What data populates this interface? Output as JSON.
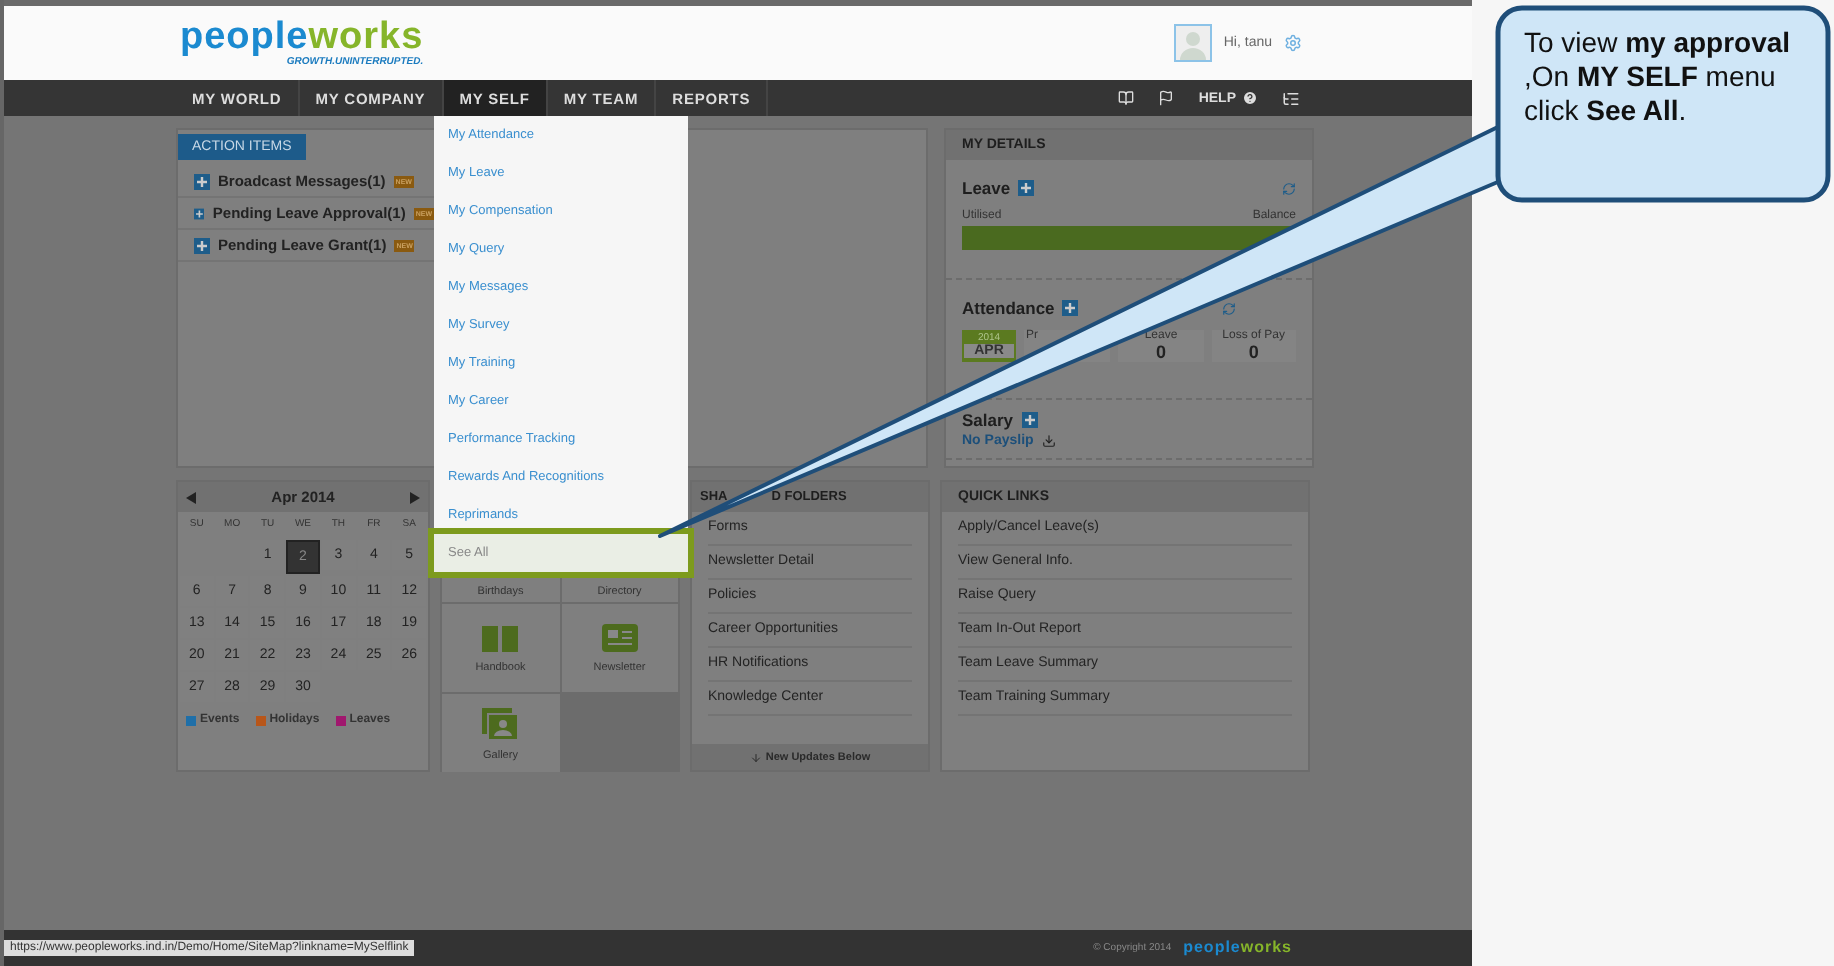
{
  "header": {
    "logo_text": "peopleworks",
    "tagline": "GROWTH.UNINTERRUPTED.",
    "greeting": "Hi, tanu"
  },
  "nav": {
    "items": [
      {
        "label": "MY WORLD",
        "selected": false
      },
      {
        "label": "MY COMPANY",
        "selected": false
      },
      {
        "label": "MY SELF",
        "selected": true
      },
      {
        "label": "MY TEAM",
        "selected": false
      },
      {
        "label": "REPORTS",
        "selected": false
      }
    ],
    "help": "HELP"
  },
  "menu": {
    "items": [
      {
        "label": "My Attendance",
        "selected": false
      },
      {
        "label": "My Leave",
        "selected": false
      },
      {
        "label": "My Compensation",
        "selected": false
      },
      {
        "label": "My Query",
        "selected": false
      },
      {
        "label": "My Messages",
        "selected": false
      },
      {
        "label": "My Survey",
        "selected": false
      },
      {
        "label": "My Training",
        "selected": false
      },
      {
        "label": "My Career",
        "selected": false
      },
      {
        "label": "Performance Tracking",
        "selected": false
      },
      {
        "label": "Rewards And Recognitions",
        "selected": false
      },
      {
        "label": "Reprimands",
        "selected": false
      },
      {
        "label": "See All",
        "selected": true
      }
    ]
  },
  "action_items": {
    "tab": "ACTION ITEMS",
    "items": [
      {
        "label": "Broadcast Messages",
        "count": "(1)",
        "badge": "NEW"
      },
      {
        "label": "Pending Leave Approval",
        "count": "(1)",
        "badge": "NEW"
      },
      {
        "label": "Pending Leave Grant",
        "count": "(1)",
        "badge": "NEW"
      }
    ]
  },
  "my_details": {
    "title": "MY DETAILS",
    "leave": {
      "title": "Leave",
      "utilised": "Utilised",
      "balance": "Balance",
      "level": 1
    },
    "attendance": {
      "title": "Attendance",
      "year": "2014",
      "month": "APR",
      "columns": [
        {
          "label": "Pr"
        },
        {
          "label": "Leave",
          "value": "0"
        },
        {
          "label": "Loss of Pay",
          "value": "0"
        }
      ]
    },
    "salary": {
      "title": "Salary",
      "link": "No Payslip"
    }
  },
  "calendar": {
    "month": "Apr 2014",
    "weekdays": [
      "SU",
      "MO",
      "TU",
      "WE",
      "TH",
      "FR",
      "SA"
    ],
    "weeks": [
      {
        "days": [
          {
            "label": "1",
            "selected": false
          },
          {
            "label": "2",
            "selected": true
          },
          {
            "label": "3",
            "selected": false
          },
          {
            "label": "4",
            "selected": false
          },
          {
            "label": "5",
            "selected": false
          }
        ]
      },
      {
        "days": [
          {
            "label": "6",
            "selected": false
          },
          {
            "label": "7",
            "selected": false
          },
          {
            "label": "8",
            "selected": false
          },
          {
            "label": "9",
            "selected": false
          },
          {
            "label": "10",
            "selected": false
          },
          {
            "label": "11",
            "selected": false
          },
          {
            "label": "12",
            "selected": false
          }
        ]
      },
      {
        "days": [
          {
            "label": "13",
            "selected": false
          },
          {
            "label": "14",
            "selected": false
          },
          {
            "label": "15",
            "selected": false
          },
          {
            "label": "16",
            "selected": false
          },
          {
            "label": "17",
            "selected": false
          },
          {
            "label": "18",
            "selected": false
          },
          {
            "label": "19",
            "selected": false
          }
        ]
      },
      {
        "days": [
          {
            "label": "20",
            "selected": false
          },
          {
            "label": "21",
            "selected": false
          },
          {
            "label": "22",
            "selected": false
          },
          {
            "label": "23",
            "selected": false
          },
          {
            "label": "24",
            "selected": false
          },
          {
            "label": "25",
            "selected": false
          },
          {
            "label": "26",
            "selected": false
          }
        ]
      },
      {
        "days": [
          {
            "label": "27",
            "selected": false
          },
          {
            "label": "28",
            "selected": false
          },
          {
            "label": "29",
            "selected": false
          },
          {
            "label": "30",
            "selected": false
          }
        ]
      }
    ],
    "legend": [
      {
        "label": "Events",
        "color": "#1f6fa8"
      },
      {
        "label": "Holidays",
        "color": "#b8561a"
      },
      {
        "label": "Leaves",
        "color": "#a0186e"
      }
    ]
  },
  "tiles": [
    {
      "label": "Birthdays",
      "kind": "text"
    },
    {
      "label": "Directory",
      "kind": "text"
    },
    {
      "label": "Handbook",
      "kind": "book"
    },
    {
      "label": "Newsletter",
      "kind": "news"
    },
    {
      "label": "Gallery",
      "kind": "gallery"
    }
  ],
  "shared_folders": {
    "title_parts": [
      "SHA",
      "D FOLDERS"
    ],
    "items": [
      "Forms",
      "Newsletter Detail",
      "Policies",
      "Career Opportunities",
      "HR Notifications",
      "Knowledge Center"
    ],
    "footer": "New Updates Below"
  },
  "quick_links": {
    "title": "QUICK LINKS",
    "items": [
      "Apply/Cancel Leave(s)",
      "View General Info.",
      "Raise Query",
      "Team In-Out Report",
      "Team Leave Summary",
      "Team Training Summary"
    ]
  },
  "status_bar": {
    "url": "https://www.peopleworks.ind.in/Demo/Home/SiteMap?linkname=MySelflink",
    "copyright": "© Copyright 2014",
    "logo_text": "peopleworks"
  },
  "callout": {
    "text": "To view **my approval** ,On **MY SELF** menu click **See All**."
  }
}
